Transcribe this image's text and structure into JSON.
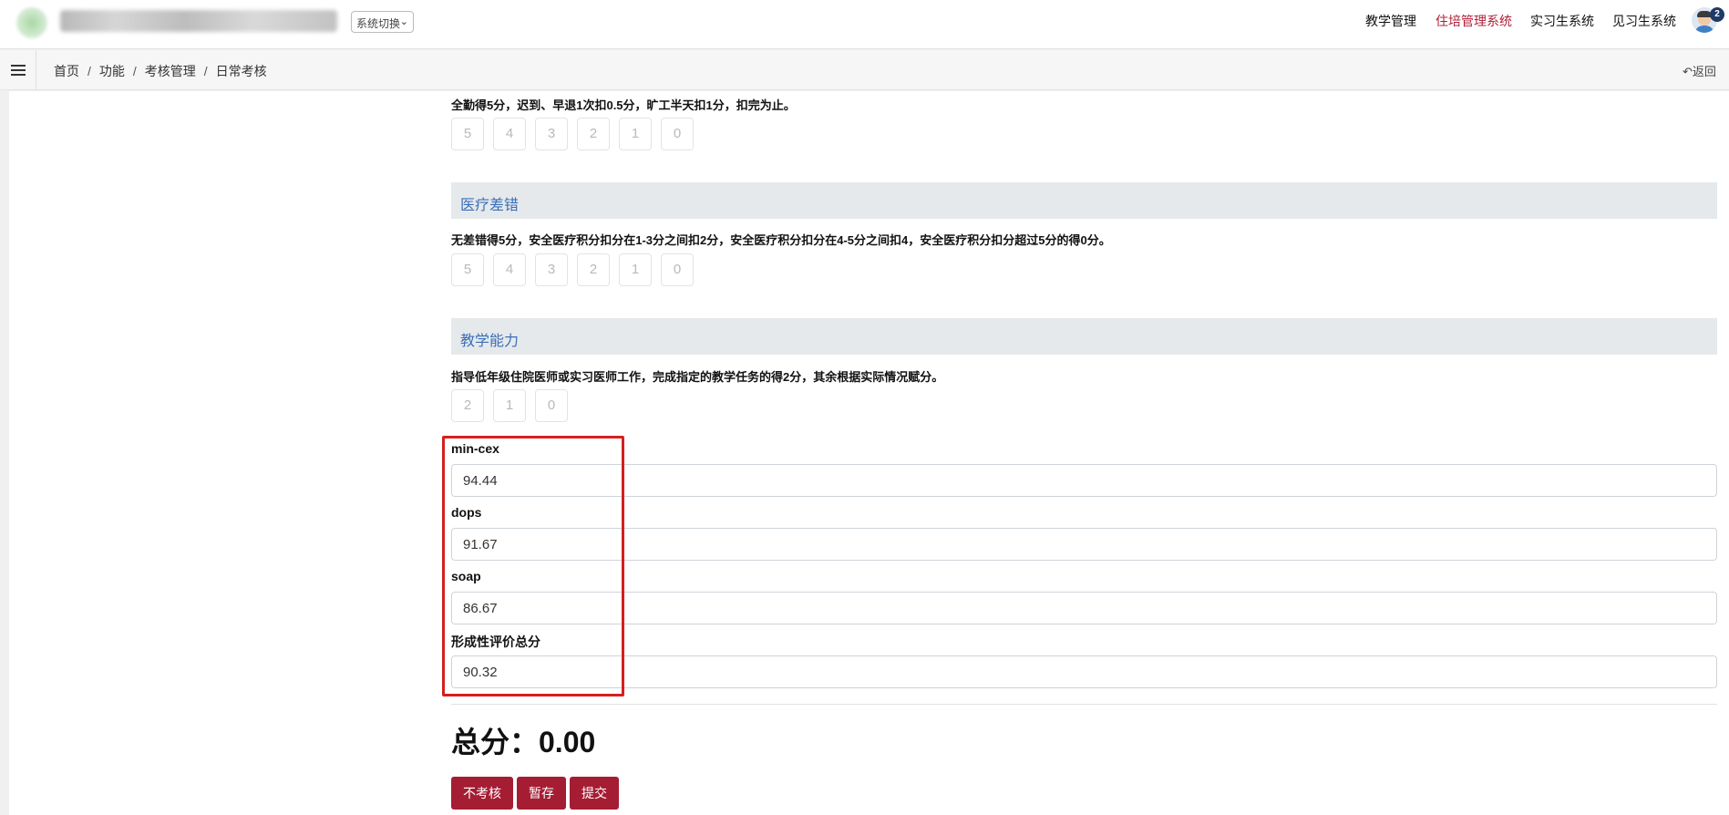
{
  "header": {
    "switch_label": "系统切换",
    "nav": [
      "教学管理",
      "住培管理系统",
      "实习生系统",
      "见习生系统"
    ],
    "active_nav": "住培管理系统",
    "notification_count": "2"
  },
  "breadcrumb": {
    "items": [
      "首页",
      "功能",
      "考核管理",
      "日常考核"
    ],
    "back_label": "返回"
  },
  "sections": [
    {
      "title": "",
      "description": "全勤得5分，迟到、早退1次扣0.5分，旷工半天扣1分，扣完为止。",
      "scores": [
        "5",
        "4",
        "3",
        "2",
        "1",
        "0"
      ]
    },
    {
      "title": "医疗差错",
      "description": "无差错得5分，安全医疗积分扣分在1-3分之间扣2分，安全医疗积分扣分在4-5分之间扣4，安全医疗积分扣分超过5分的得0分。",
      "scores": [
        "5",
        "4",
        "3",
        "2",
        "1",
        "0"
      ]
    },
    {
      "title": "教学能力",
      "description": "指导低年级住院医师或实习医师工作，完成指定的教学任务的得2分，其余根据实际情况赋分。",
      "scores": [
        "2",
        "1",
        "0"
      ]
    }
  ],
  "fields": [
    {
      "label": "min-cex",
      "value": "94.44"
    },
    {
      "label": "dops",
      "value": "91.67"
    },
    {
      "label": "soap",
      "value": "86.67"
    },
    {
      "label": "形成性评价总分",
      "value": "90.32"
    }
  ],
  "total": {
    "text": "总分：0.00"
  },
  "actions": [
    "不考核",
    "暂存",
    "提交"
  ],
  "colors": {
    "brand": "#a51d33",
    "active_nav": "#b0203a",
    "section_title": "#3a6fb7",
    "section_bg": "#e6e9ec",
    "highlight": "#d61f1f"
  }
}
